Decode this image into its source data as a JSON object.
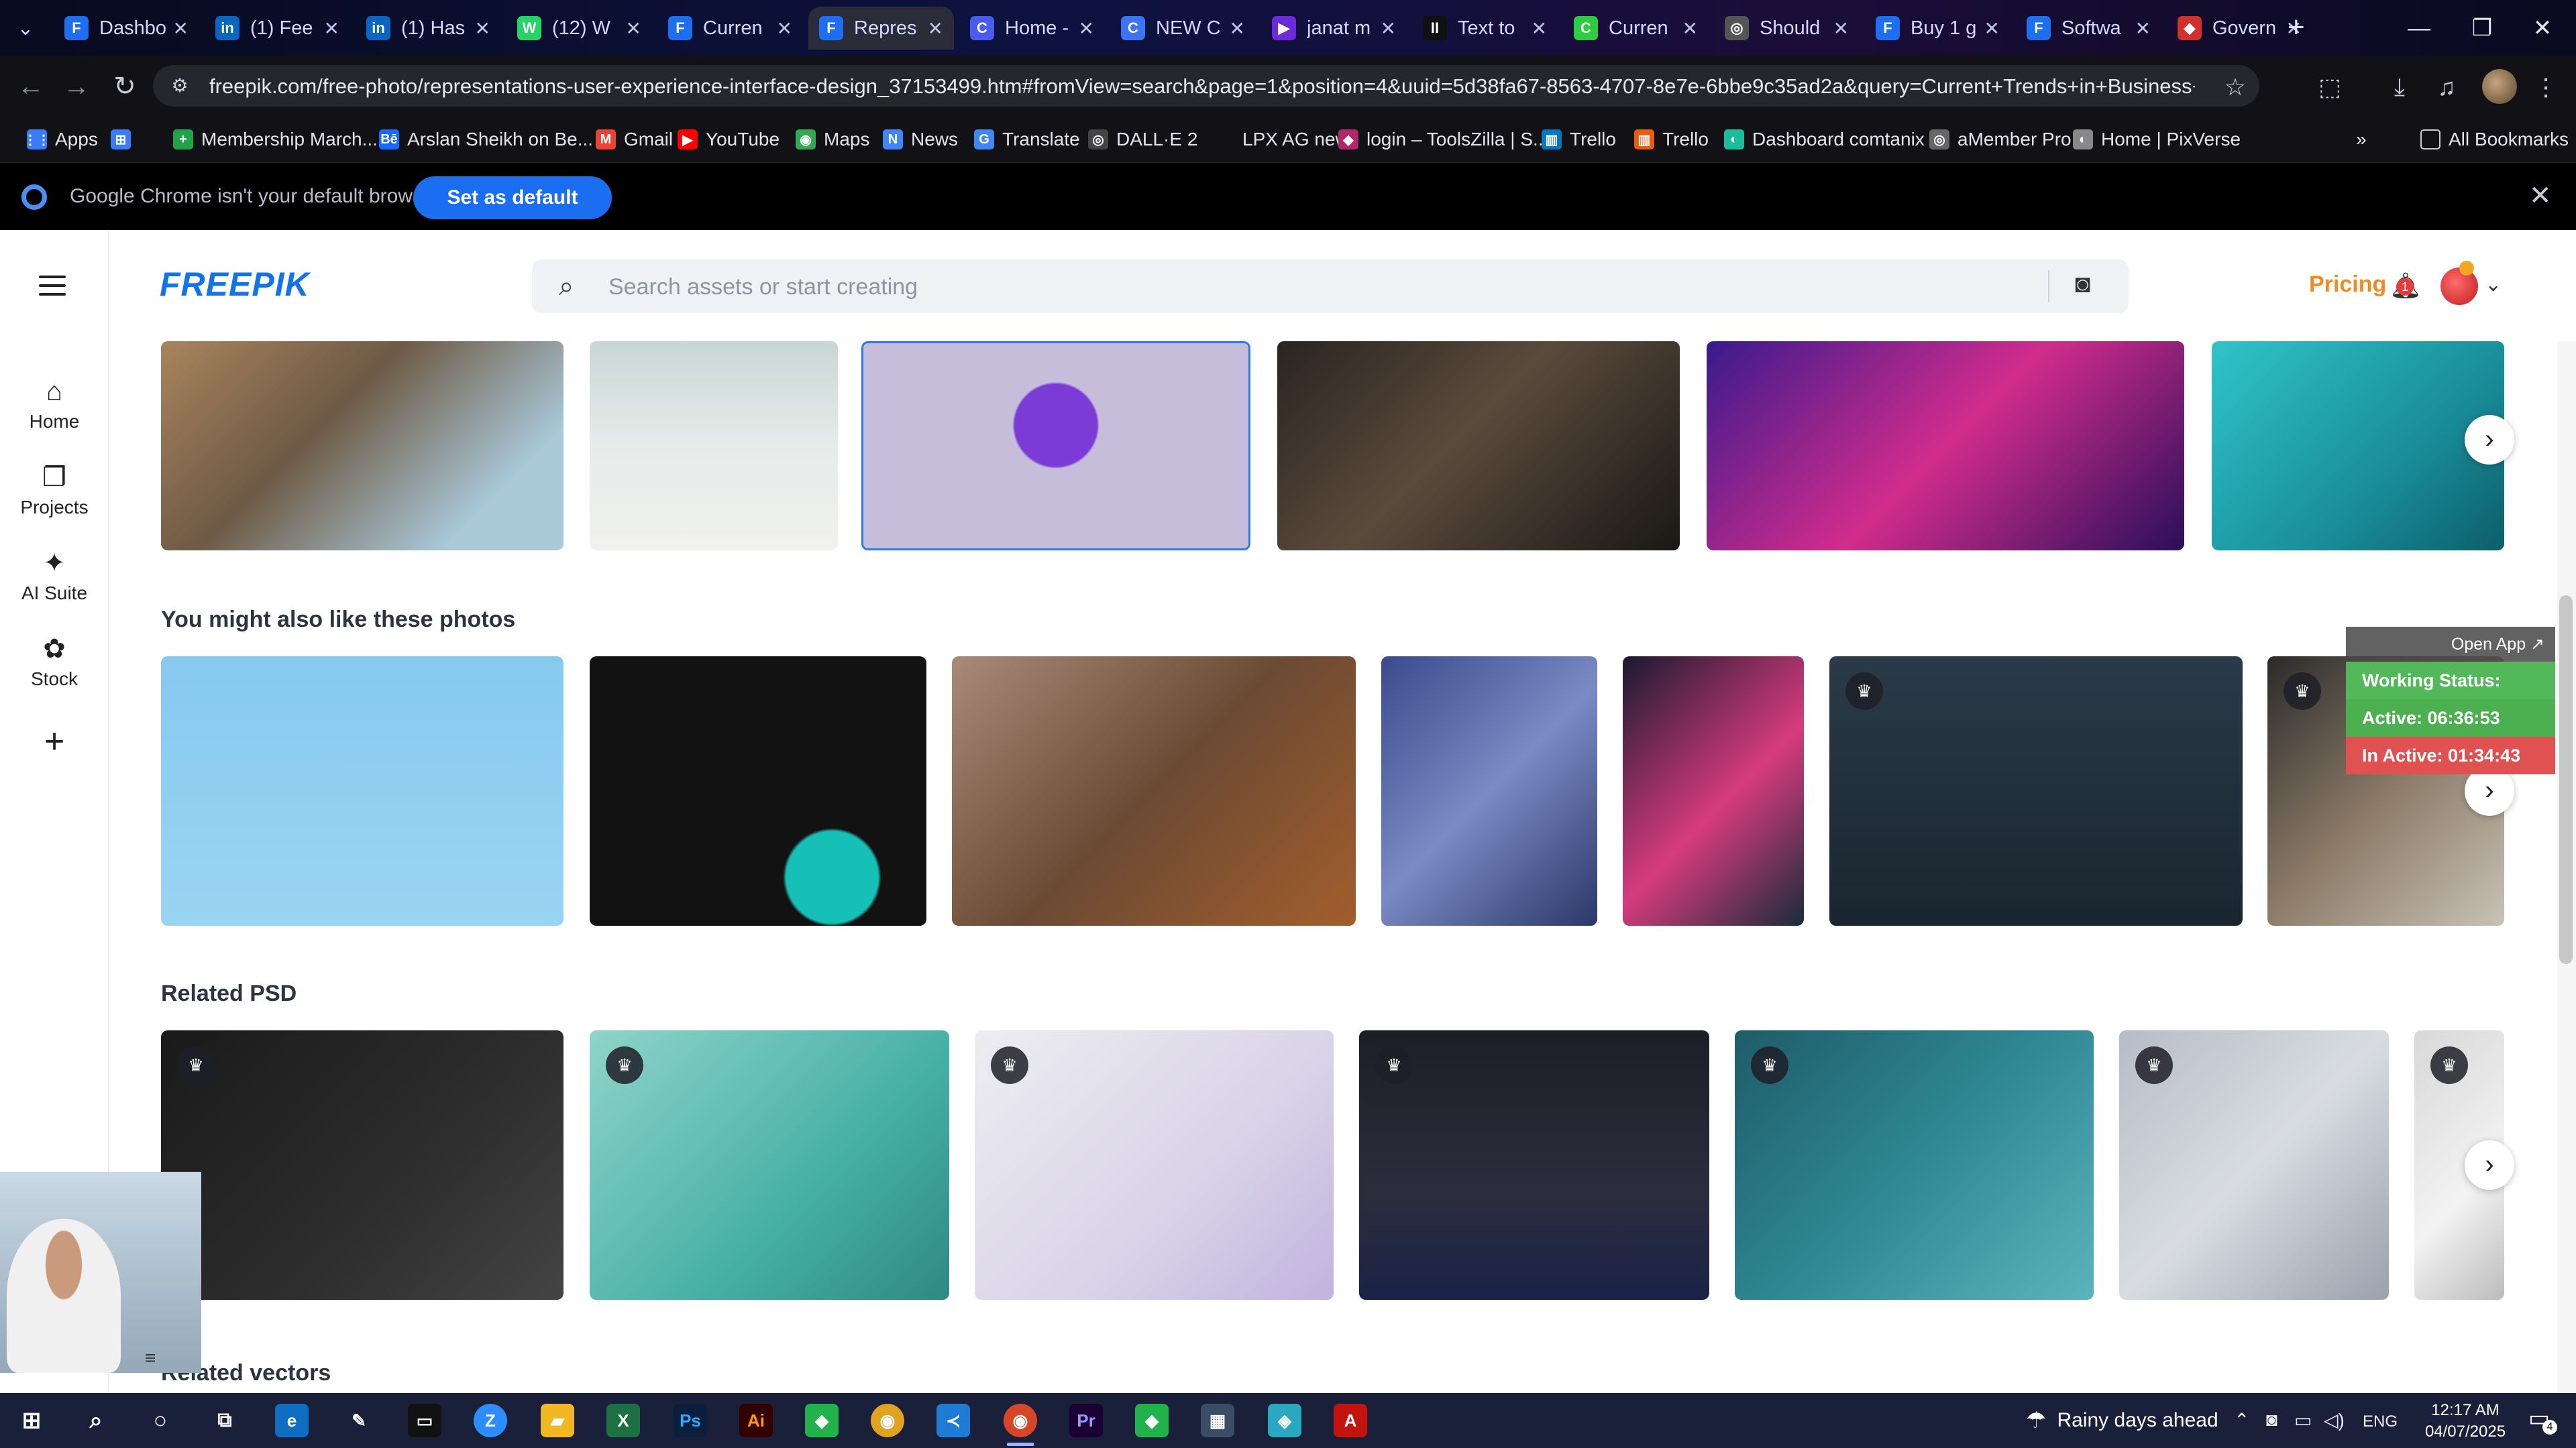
{
  "tabs": [
    {
      "title": "Dashbo",
      "icon_color": "#1d6ef0",
      "icon": "F"
    },
    {
      "title": "(1) Fee",
      "icon_color": "#0a66c2",
      "icon": "in"
    },
    {
      "title": "(1) Has",
      "icon_color": "#0a66c2",
      "icon": "in"
    },
    {
      "title": "(12) W",
      "icon_color": "#25d366",
      "icon": "W"
    },
    {
      "title": "Curren",
      "icon_color": "#1d6ef0",
      "icon": "F"
    },
    {
      "title": "Repres",
      "icon_color": "#1d6ef0",
      "icon": "F"
    },
    {
      "title": "Home -",
      "icon_color": "#4a5cf0",
      "icon": "C"
    },
    {
      "title": "NEW C",
      "icon_color": "#3c74f5",
      "icon": "C"
    },
    {
      "title": "janat m",
      "icon_color": "#6c2bd9",
      "icon": "▶"
    },
    {
      "title": "Text to",
      "icon_color": "#111111",
      "icon": "II"
    },
    {
      "title": "Curren",
      "icon_color": "#2ecc40",
      "icon": "C"
    },
    {
      "title": "Should",
      "icon_color": "#555555",
      "icon": "◎"
    },
    {
      "title": "Buy 1 g",
      "icon_color": "#1d6ef0",
      "icon": "F"
    },
    {
      "title": "Softwa",
      "icon_color": "#1d6ef0",
      "icon": "F"
    },
    {
      "title": "Govern",
      "icon_color": "#d0312d",
      "icon": "◆"
    }
  ],
  "toolbar": {
    "url": "freepik.com/free-photo/representations-user-experience-interface-design_37153499.htm#fromView=search&page=1&position=4&uuid=5d38fa67-8563-4707-8e7e-6bbe9c35ad2a&query=Current+Trends+in+Business+Website+Design+and..."
  },
  "bookmarks": {
    "items": [
      {
        "label": "Apps",
        "icon": "⋮⋮",
        "color": "#3a7cf5"
      },
      {
        "label": "",
        "icon": "⊞",
        "color": "#3a7cf5"
      },
      {
        "label": "Membership March...",
        "icon": "+",
        "color": "#22a34a"
      },
      {
        "label": "Arslan Sheikh on Be...",
        "icon": "Bē",
        "color": "#1769ff"
      },
      {
        "label": "Gmail",
        "icon": "M",
        "color": "#ea4335"
      },
      {
        "label": "YouTube",
        "icon": "▶",
        "color": "#ff0000"
      },
      {
        "label": "Maps",
        "icon": "◉",
        "color": "#34a853"
      },
      {
        "label": "News",
        "icon": "N",
        "color": "#4285f4"
      },
      {
        "label": "Translate",
        "icon": "G",
        "color": "#4285f4"
      },
      {
        "label": "DALL·E 2",
        "icon": "◎",
        "color": "#444444"
      },
      {
        "label": "LPX AG new",
        "icon": "",
        "color": "#111116"
      },
      {
        "label": "login – ToolsZilla | S...",
        "icon": "◆",
        "color": "#b0286b"
      },
      {
        "label": "Trello",
        "icon": "▥",
        "color": "#0079bf"
      },
      {
        "label": "Trello",
        "icon": "▥",
        "color": "#e85c0d"
      },
      {
        "label": "Dashboard comtanix",
        "icon": "◐",
        "color": "#1abc9c"
      },
      {
        "label": "aMember Pro",
        "icon": "◎",
        "color": "#666666"
      },
      {
        "label": "Home | PixVerse",
        "icon": "◐",
        "color": "#888888"
      }
    ],
    "overflow": "»",
    "all_bookmarks": "All Bookmarks"
  },
  "infobar": {
    "message": "Google Chrome isn't your default browser",
    "button": "Set as default"
  },
  "freepik": {
    "logo": "FREEPIK",
    "search_placeholder": "Search assets or start creating",
    "pricing": "Pricing",
    "notification_count": "1"
  },
  "sidebar": {
    "items": [
      {
        "label": "Home",
        "icon": "⌂"
      },
      {
        "label": "Projects",
        "icon": "❐"
      },
      {
        "label": "AI Suite",
        "icon": "✦"
      },
      {
        "label": "Stock",
        "icon": "✿"
      },
      {
        "label": "",
        "icon": "+"
      }
    ]
  },
  "sections": {
    "also_like": "You might also like these photos",
    "related_psd": "Related PSD",
    "related_vectors": "Related vectors"
  },
  "overlay": {
    "open_app": "Open App ↗",
    "working_status": "Working Status: Active",
    "active": "Active: 06:36:53",
    "inactive": "In Active: 01:34:43",
    "colors": {
      "status": "#53b85a",
      "active": "#4caf50",
      "inactive": "#e05252"
    }
  },
  "taskbar": {
    "weather": "Rainy days ahead",
    "language": "ENG",
    "time": "12:17 AM",
    "date": "04/07/2025",
    "notifications": "4"
  }
}
